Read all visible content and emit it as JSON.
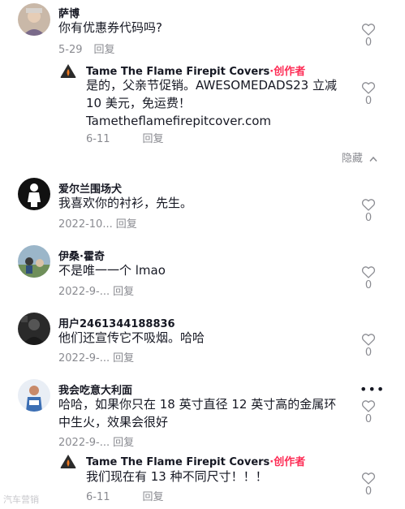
{
  "comments": [
    {
      "user": "萨博",
      "text": "你有优惠券代码吗?",
      "date": "5-29",
      "reply": "回复",
      "likes": "0",
      "replies": [
        {
          "user": "Tame The Flame Firepit Covers",
          "creator_tag": "·创作者",
          "text": "是的，父亲节促销。AWESOMEDADS23 立减 10 美元，免运费！ Tametheflamefirepitcover.com",
          "date": "6-11",
          "reply": "回复",
          "likes": "0"
        }
      ],
      "hide_label": "隐藏"
    },
    {
      "user": "爱尔兰围场犬",
      "text": "我喜欢你的衬衫，先生。",
      "date": "2022-10...",
      "reply": "回复",
      "likes": "0"
    },
    {
      "user": "伊桑·霍奇",
      "text": "不是唯一一个 lmao",
      "date": "2022-9-...",
      "reply": "回复",
      "likes": "0"
    },
    {
      "user": "用户2461344188836",
      "text": "他们还宣传它不吸烟。哈哈",
      "date": "2022-9-...",
      "reply": "回复",
      "likes": "0"
    },
    {
      "user": "我会吃意大利面",
      "text": "哈哈，如果你只在 18 英寸直径 12 英寸高的金属环中生火，效果会很好",
      "date": "2022-9-...",
      "reply": "回复",
      "likes": "0",
      "replies": [
        {
          "user": "Tame The Flame Firepit Covers",
          "creator_tag": "·创作者",
          "text": "我们现在有 13 种不同尺寸！！！",
          "date": "6-11",
          "reply": "回复",
          "likes": "0"
        }
      ]
    }
  ],
  "watermark": "汽车营销",
  "icons": {
    "like": "heart-outline-icon",
    "collapse": "chevron-up-icon",
    "more": "more-horizontal-icon"
  }
}
